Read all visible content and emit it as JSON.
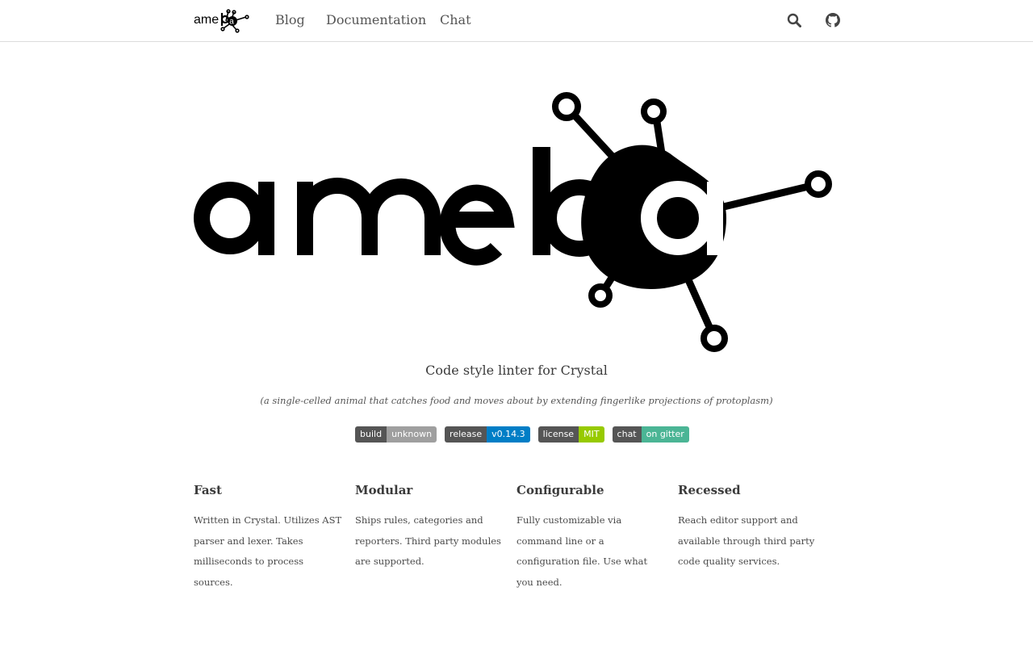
{
  "nav": {
    "brand_text": "ameba",
    "links": [
      {
        "label": "Blog"
      },
      {
        "label": "Documentation"
      },
      {
        "label": "Chat"
      }
    ],
    "search_icon": "search-icon",
    "github_icon": "github-icon"
  },
  "hero": {
    "logo_text": "ameba",
    "tagline": "Code style linter for Crystal",
    "subtagline": "(a single-celled animal that catches food and moves about by extending fingerlike projections of protoplasm)"
  },
  "badges": [
    {
      "left": "build",
      "right": "unknown",
      "color": "#9f9f9f"
    },
    {
      "left": "release",
      "right": "v0.14.3",
      "color": "#007ec6"
    },
    {
      "left": "license",
      "right": "MIT",
      "color": "#97ca00"
    },
    {
      "left": "chat",
      "right": "on gitter",
      "color": "#4bb595"
    }
  ],
  "features": [
    {
      "title": "Fast",
      "text": "Written in Crystal. Utilizes AST parser and lexer. Takes milliseconds to process sources."
    },
    {
      "title": "Modular",
      "text": "Ships rules, categories and reporters. Third party modules are supported."
    },
    {
      "title": "Configurable",
      "text": "Fully customizable via command line or a configuration file. Use what you need."
    },
    {
      "title": "Recessed",
      "text": "Reach editor support and available through third party code quality services."
    }
  ]
}
